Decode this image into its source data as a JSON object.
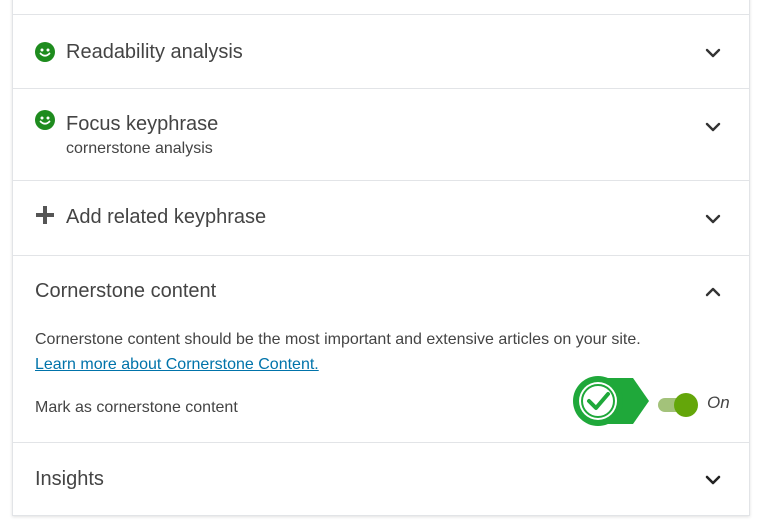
{
  "colors": {
    "accent_green": "#64a60a",
    "smiley_green": "#1e8c1e",
    "link_blue": "#0073aa",
    "callout_green": "#1fa83a",
    "text": "#444444"
  },
  "sections": {
    "readability": {
      "title": "Readability analysis",
      "status_icon": "smiley-good-icon",
      "state": "collapsed"
    },
    "focus_keyphrase": {
      "title": "Focus keyphrase",
      "subtitle": "cornerstone analysis",
      "status_icon": "smiley-good-icon",
      "state": "collapsed"
    },
    "related_keyphrase": {
      "title": "Add related keyphrase",
      "icon": "plus-icon",
      "state": "collapsed"
    },
    "cornerstone": {
      "title": "Cornerstone content",
      "state": "expanded",
      "description": "Cornerstone content should be the most important and extensive articles on your site.",
      "learn_more": "Learn more about Cornerstone Content.",
      "toggle_label": "Mark as cornerstone content",
      "toggle_on": true,
      "toggle_state_text": "On"
    },
    "insights": {
      "title": "Insights",
      "state": "collapsed"
    }
  }
}
